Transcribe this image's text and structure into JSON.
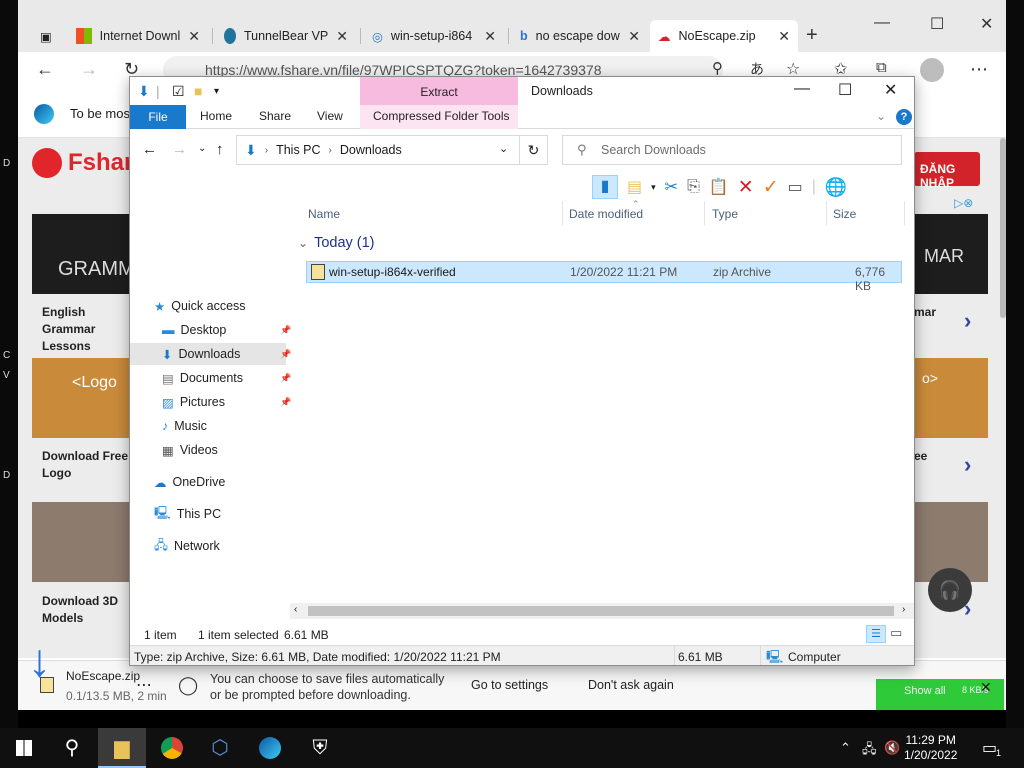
{
  "browser": {
    "tabs": [
      {
        "title": "Internet Downl"
      },
      {
        "title": "TunnelBear VP"
      },
      {
        "title": "win-setup-i864"
      },
      {
        "title": "no escape dow"
      },
      {
        "title": "NoEscape.zip"
      }
    ],
    "url": "https://www.fshare.vn/file/97WPICSPTQZG?token=1642739378",
    "infobar_text": "To be mos",
    "page": {
      "logo_text": "Fshar",
      "login_label": "ĐĂNG NHẬP",
      "cards": [
        {
          "title": "English Grammar Lessons",
          "img_text": "GRAMM"
        },
        {
          "title": "Download Free Logo",
          "img_text": "<Logo"
        },
        {
          "title": "Download 3D Models",
          "img_text": ""
        }
      ],
      "right_cards": [
        {
          "title": "mar",
          "img_text": "MAR"
        },
        {
          "title": "ee",
          "img_text": "o>"
        }
      ]
    },
    "download_bar": {
      "file_name": "NoEscape.zip",
      "progress": "0.1/13.5 MB, 2 min",
      "message": "You can choose to save files automatically or be prompted before downloading.",
      "go_to_settings": "Go to settings",
      "dont_ask": "Don't ask again",
      "show_all": "Show all",
      "speed": "8 KB/s"
    }
  },
  "explorer": {
    "caption": "Downloads",
    "context_tab": "Extract",
    "ribbon_tabs": [
      "File",
      "Home",
      "Share",
      "View",
      "Compressed Folder Tools"
    ],
    "breadcrumb": [
      "This PC",
      "Downloads"
    ],
    "search_placeholder": "Search Downloads",
    "nav": {
      "quick_access": "Quick access",
      "items": [
        "Desktop",
        "Downloads",
        "Documents",
        "Pictures",
        "Music",
        "Videos"
      ],
      "onedrive": "OneDrive",
      "this_pc": "This PC",
      "network": "Network"
    },
    "columns": [
      "Name",
      "Date modified",
      "Type",
      "Size"
    ],
    "group": "Today (1)",
    "files": [
      {
        "name": "win-setup-i864x-verified",
        "date": "1/20/2022 11:21 PM",
        "type": "zip Archive",
        "size": "6,776 KB"
      }
    ],
    "status": {
      "count": "1 item",
      "selected": "1 item selected",
      "size": "6.61 MB"
    },
    "details": {
      "text": "Type: zip Archive, Size: 6.61 MB, Date modified: 1/20/2022 11:21 PM",
      "size": "6.61 MB",
      "location": "Computer"
    }
  },
  "taskbar": {
    "time": "11:29 PM",
    "date": "1/20/2022",
    "notifications": "1"
  }
}
